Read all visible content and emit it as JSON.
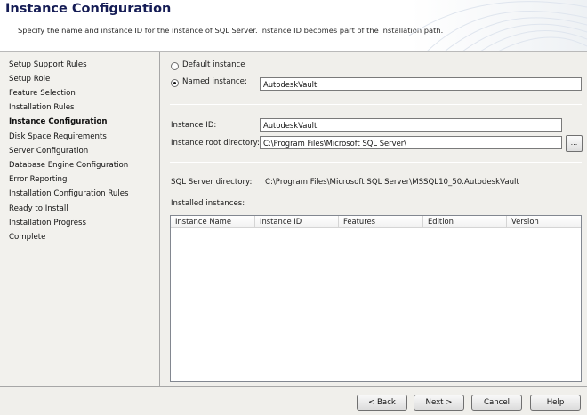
{
  "header": {
    "title": "Instance Configuration",
    "subtitle": "Specify the name and instance ID for the instance of SQL Server. Instance ID becomes part of the installation path."
  },
  "nav": {
    "items": [
      {
        "label": "Setup Support Rules",
        "active": false
      },
      {
        "label": "Setup Role",
        "active": false
      },
      {
        "label": "Feature Selection",
        "active": false
      },
      {
        "label": "Installation Rules",
        "active": false
      },
      {
        "label": "Instance Configuration",
        "active": true
      },
      {
        "label": "Disk Space Requirements",
        "active": false
      },
      {
        "label": "Server Configuration",
        "active": false
      },
      {
        "label": "Database Engine Configuration",
        "active": false
      },
      {
        "label": "Error Reporting",
        "active": false
      },
      {
        "label": "Installation Configuration Rules",
        "active": false
      },
      {
        "label": "Ready to Install",
        "active": false
      },
      {
        "label": "Installation Progress",
        "active": false
      },
      {
        "label": "Complete",
        "active": false
      }
    ]
  },
  "instance": {
    "default_label": "Default instance",
    "named_label": "Named instance:",
    "named_value": "AutodeskVault",
    "selected": "named"
  },
  "instance_id": {
    "label": "Instance ID:",
    "value": "AutodeskVault"
  },
  "root_dir": {
    "label": "Instance root directory:",
    "value": "C:\\Program Files\\Microsoft SQL Server\\",
    "browse_label": "..."
  },
  "sql_dir": {
    "label": "SQL Server directory:",
    "value": "C:\\Program Files\\Microsoft SQL Server\\MSSQL10_50.AutodeskVault"
  },
  "installed": {
    "label": "Installed instances:",
    "columns": [
      "Instance Name",
      "Instance ID",
      "Features",
      "Edition",
      "Version"
    ],
    "rows": []
  },
  "footer": {
    "back": "< Back",
    "next": "Next >",
    "cancel": "Cancel",
    "help": "Help"
  }
}
